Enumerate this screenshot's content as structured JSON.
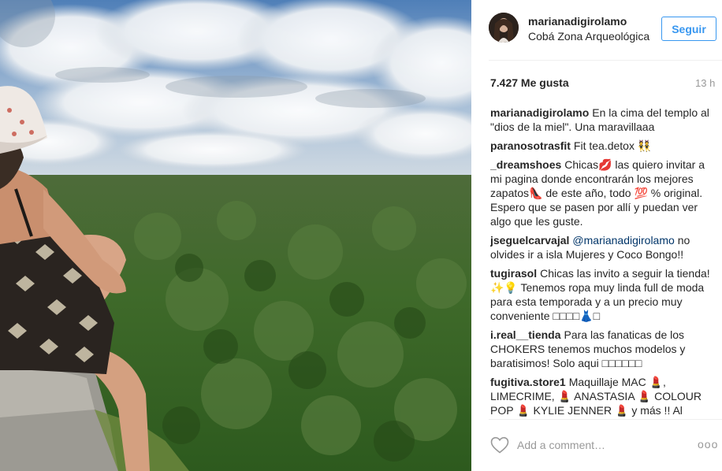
{
  "post": {
    "username": "marianadigirolamo",
    "location": "Cobá Zona Arqueológica",
    "follow_label": "Seguir",
    "likes": "7.427 Me gusta",
    "time_ago": "13 h"
  },
  "comments": [
    {
      "user": "marianadigirolamo",
      "text": "En la cima del templo al \"dios de la miel\". Una maravillaaa"
    },
    {
      "user": "paranosotrasfit",
      "text": "Fit tea.detox 👯"
    },
    {
      "user": "_dreamshoes",
      "text": "Chicas💋 las quiero invitar a mi pagina donde encontrarán los mejores zapatos👠 de este año, todo 💯 % original. Espero que se pasen por allí y puedan ver algo que les guste."
    },
    {
      "user": "jseguelcarvajal",
      "mention": "@marianadigirolamo",
      "text": "no olvides ir a isla Mujeres y Coco Bongo!!"
    },
    {
      "user": "tugirasol",
      "text": "Chicas las invito a seguir la tienda! ✨💡 Tenemos ropa muy linda full de moda para esta temporada y a un precio muy conveniente □□□□👗□"
    },
    {
      "user": "i.real__tienda",
      "text": "Para las fanaticas de los CHOKERS tenemos muchos modelos y baratisimos! Solo aqui □□□□□□"
    },
    {
      "user": "fugitiva.store1",
      "text": "Maquillaje MAC 💄, LIMECRIME, 💄 ANASTASIA 💄 COLOUR POP 💄 KYLIE JENNER 💄 y más !! Al"
    }
  ],
  "footer": {
    "add_comment_placeholder": "Add a comment…",
    "more_label": "ooo"
  },
  "icons": {
    "heart": "heart-icon",
    "more": "more-options-icon"
  },
  "colors": {
    "accent": "#3897f0",
    "mention": "#003569",
    "muted": "#999999"
  }
}
